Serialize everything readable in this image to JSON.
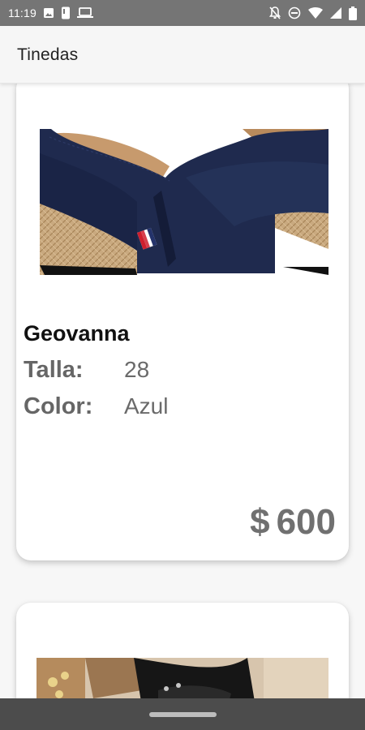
{
  "status_bar": {
    "time": "11:19",
    "left_icons": [
      "image-icon",
      "phone-icon",
      "laptop-icon"
    ],
    "right_icons": [
      "mute-icon",
      "dnd-icon",
      "wifi-icon",
      "signal-icon",
      "battery-icon"
    ]
  },
  "app_bar": {
    "title": "Tinedas"
  },
  "products": [
    {
      "name": "Geovanna",
      "size_label": "Talla:",
      "size_value": "28",
      "color_label": "Color:",
      "color_value": "Azul",
      "currency": "$",
      "price": "600"
    }
  ],
  "colors": {
    "status_bar": "#757575",
    "app_bar": "#f6f6f6",
    "nav_bar": "#4c4c4c",
    "shoe_navy": "#1f2a4e",
    "jute": "#c7a780"
  }
}
